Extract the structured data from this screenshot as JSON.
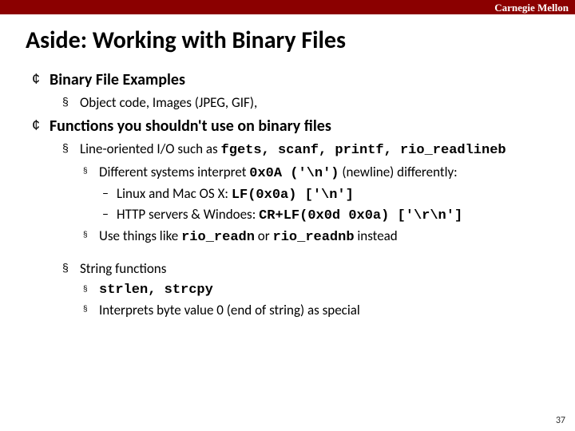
{
  "header": {
    "brand": "Carnegie Mellon"
  },
  "title": "Aside: Working with Binary Files",
  "bullets": {
    "b1_examples": "Binary File Examples",
    "b2_examples_sub": "Object code, Images (JPEG, GIF),",
    "b1_funcs": "Functions you shouldn't use on binary files",
    "b2_lineio_pre": "Line-oriented I/O such as ",
    "b2_lineio_code": "fgets, scanf, printf, rio_readlineb",
    "b3_diff_pre": "Different systems interpret ",
    "b3_diff_code": "0x0A ('\\n')",
    "b3_diff_post": " (newline) differently:",
    "b4_linux_pre": "Linux and Mac OS X: ",
    "b4_linux_code": "LF(0x0a) ['\\n']",
    "b4_http_pre": "HTTP servers & Windoes: ",
    "b4_http_code": "CR+LF(0x0d 0x0a) ['\\r\\n']",
    "b3_use_pre": "Use things like ",
    "b3_use_code1": "rio_readn",
    "b3_use_mid": " or ",
    "b3_use_code2": "rio_readnb",
    "b3_use_post": " instead",
    "b2_strfunc": "String functions",
    "b3_str_code": "strlen, strcpy",
    "b3_str_interp": "Interprets byte value 0 (end of string) as special"
  },
  "markers": {
    "hollow": "¢",
    "square": "§",
    "small": "§",
    "dash": "–"
  },
  "pagenum": "37"
}
